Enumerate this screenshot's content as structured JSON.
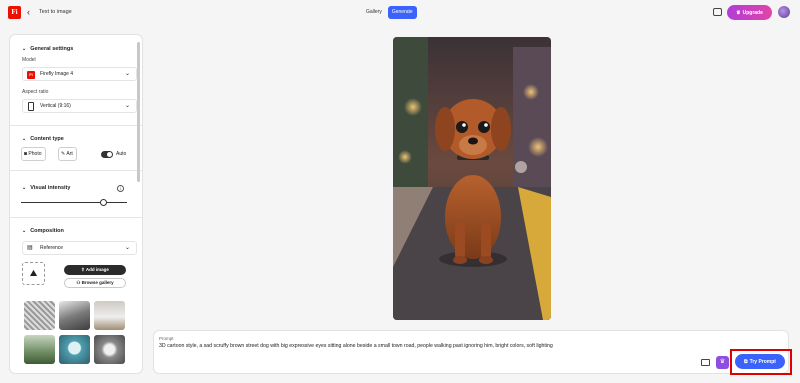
{
  "header": {
    "app_logo": "Fi",
    "breadcrumb": "Text to image",
    "tabs": [
      {
        "label": "Gallery",
        "active": false
      },
      {
        "label": "Generate",
        "active": true
      }
    ],
    "upgrade_label": "Upgrade",
    "accent": "#3b63fb",
    "upgrade_gradient": [
      "#b23cd9",
      "#e045a6"
    ]
  },
  "sidebar": {
    "general": {
      "title": "General settings",
      "model_label": "Model",
      "model_value": "Firefly Image 4",
      "aspect_label": "Aspect ratio",
      "aspect_value": "Vertical (9:16)"
    },
    "content_type": {
      "title": "Content type",
      "options": [
        "Photo",
        "Art"
      ],
      "auto_label": "Auto",
      "auto_on": true
    },
    "visual_intensity": {
      "title": "Visual intensity",
      "info_icon": "info-icon",
      "value_fraction": 0.78
    },
    "composition": {
      "title": "Composition",
      "reference_label": "Reference",
      "upload_label": "Add image",
      "browse_label": "Browse gallery",
      "thumb_count": 6
    }
  },
  "canvas": {
    "image_subject": "cartoon-style-dog-on-road",
    "bg_colors": [
      "#4f3a3a",
      "#c9794e",
      "#d9a35b"
    ]
  },
  "prompt": {
    "label": "Prompt",
    "text": "3D cartoon style, a sad scruffy brown street dog with big expressive eyes sitting alone beside a small town road, people walking past ignoring him, bright colors, soft lighting",
    "try_label": "Try Prompt",
    "highlight_color": "#e00000"
  }
}
